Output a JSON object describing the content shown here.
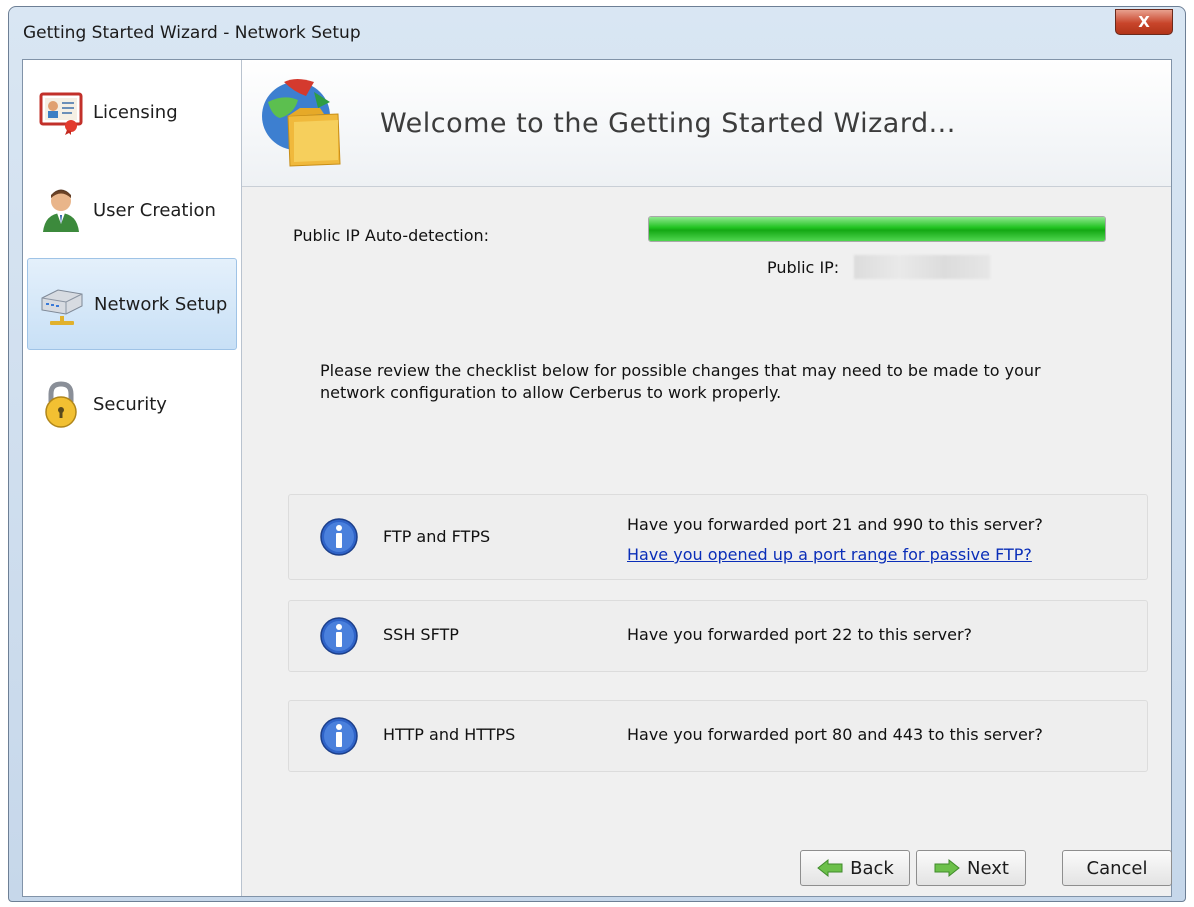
{
  "window": {
    "title": "Getting Started Wizard - Network Setup",
    "close_label": "X"
  },
  "sidebar": {
    "items": [
      {
        "label": "Licensing",
        "icon": "certificate-icon"
      },
      {
        "label": "User Creation",
        "icon": "user-icon"
      },
      {
        "label": "Network Setup",
        "icon": "network-icon",
        "active": true
      },
      {
        "label": "Security",
        "icon": "lock-icon"
      }
    ]
  },
  "banner": {
    "title": "Welcome to the Getting Started Wizard...",
    "icon": "globe-folder-icon"
  },
  "ip": {
    "auto_detect_label": "Public IP Auto-detection:",
    "progress_fraction": 1.0,
    "progress_color": "#1fc21f",
    "public_ip_label": "Public IP:"
  },
  "review_text": "Please review the checklist below for possible changes that may need to be made to your network configuration to allow Cerberus to work properly.",
  "checklist": [
    {
      "name": "FTP and FTPS",
      "question": "Have you forwarded port 21 and 990 to this server?",
      "link": "Have you opened up a port range for passive FTP?"
    },
    {
      "name": "SSH SFTP",
      "question": "Have you forwarded port 22 to this server?"
    },
    {
      "name": "HTTP and HTTPS",
      "question": "Have you forwarded port 80 and 443 to this server?"
    }
  ],
  "buttons": {
    "back": "Back",
    "next": "Next",
    "cancel": "Cancel"
  },
  "colors": {
    "link": "#0a2eb8",
    "active_nav": "#c8e0f6",
    "close": "#c8452b"
  }
}
